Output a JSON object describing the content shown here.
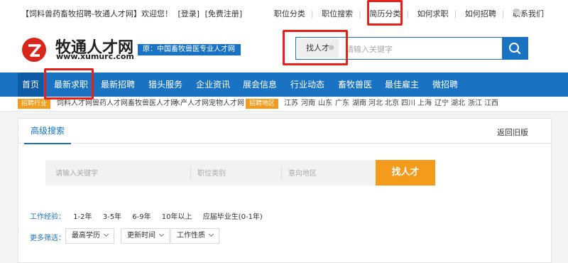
{
  "topbar": {
    "welcome": "【饲料兽药畜牧招聘-牧通人才网】欢迎您！",
    "login": "[登录]",
    "register": "[免费注册]",
    "links": [
      "职位分类",
      "职位搜索",
      "简历分类",
      "如何求职",
      "如何招聘",
      "联系我们"
    ]
  },
  "header": {
    "logo_cn": "牧通人才网",
    "logo_en": "www.xumurc.com",
    "slogan": "原：中国畜牧兽医专业人才网",
    "search": {
      "tag": "找人才",
      "tag_close": "⊗",
      "placeholder": "请输入关键字"
    }
  },
  "nav": {
    "items": [
      "首页",
      "最新求职",
      "最新招聘",
      "猎头服务",
      "企业资讯",
      "展会信息",
      "行业动态",
      "畜牧兽医",
      "最佳雇主",
      "微招聘"
    ]
  },
  "tags": {
    "industry_label": "招聘行业",
    "industry": [
      "饲料人才网",
      "兽药人才网",
      "畜牧兽医人才网",
      "水产人才网",
      "宠物人才网"
    ],
    "region_label": "招聘地区",
    "regions": [
      "江苏",
      "河南",
      "山东",
      "广东",
      "湖南",
      "河北",
      "北京",
      "四川",
      "上海",
      "辽宁",
      "湖北",
      "浙江",
      "江西"
    ]
  },
  "panel": {
    "tab": "高级搜索",
    "back_old": "返回旧版",
    "keyword_placeholder": "请输入关键字",
    "category_placeholder": "职位类别",
    "region_placeholder": "意向地区",
    "find_button": "找人才",
    "experience": {
      "label": "工作经验：",
      "options": [
        "1-2年",
        "3-5年",
        "6-9年",
        "10年以上",
        "应届毕业生(0-1年)"
      ]
    },
    "more": {
      "label": "更多筛选：",
      "dropdowns": [
        "最高学历",
        "更新时间",
        "工作性质"
      ]
    }
  },
  "colors": {
    "brand_blue": "#1a73c2",
    "accent_orange": "#f59b1b",
    "highlight_red": "#e8201b"
  }
}
